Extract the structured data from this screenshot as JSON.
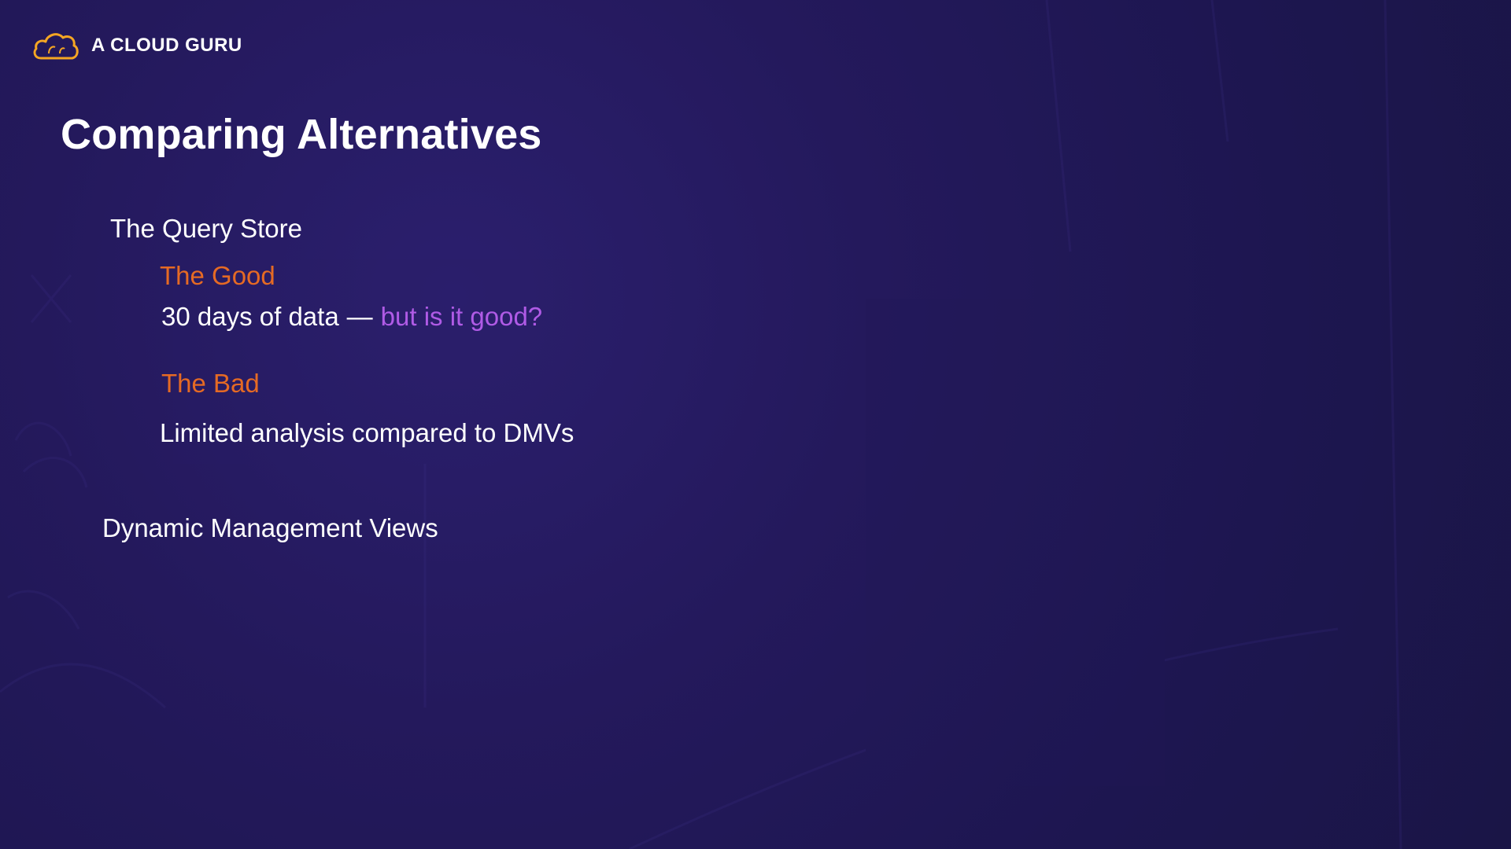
{
  "brand": {
    "name": "A CLOUD GURU",
    "logo_icon": "cloud-logo-icon",
    "logo_color": "#f5a623"
  },
  "slide": {
    "title": "Comparing Alternatives",
    "section1_heading": "The Query Store",
    "good_heading": "The Good",
    "good_text": "30 days of data",
    "good_separator": "—",
    "good_accent_text": "but is it good?",
    "bad_heading": "The Bad",
    "bad_text": "Limited analysis compared to DMVs",
    "section2_heading": "Dynamic Management Views"
  },
  "colors": {
    "background": "#24195c",
    "heading_orange": "#e56a24",
    "accent_purple": "#b05be6",
    "text": "#ffffff"
  }
}
